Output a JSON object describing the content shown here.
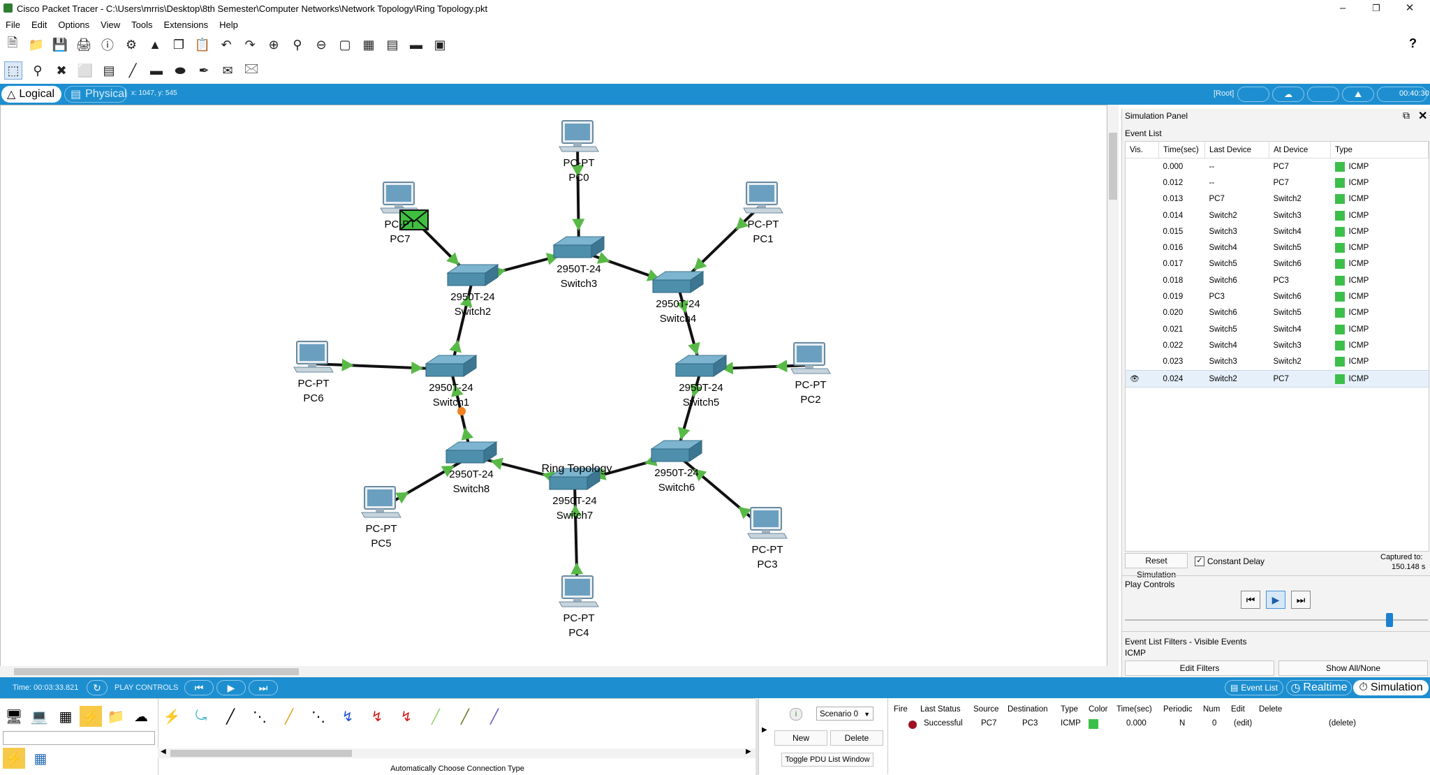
{
  "window": {
    "title": "Cisco Packet Tracer - C:\\Users\\mrris\\Desktop\\8th Semester\\Computer Networks\\Network Topology\\Ring Topology.pkt",
    "minimize": "–",
    "restore": "❐",
    "close": "✕"
  },
  "menu": [
    "File",
    "Edit",
    "Options",
    "View",
    "Tools",
    "Extensions",
    "Help"
  ],
  "help_icon": "?",
  "modebar": {
    "logical": "Logical",
    "physical": "Physical",
    "coords": "x: 1047, y: 545",
    "root": "[Root]",
    "clock": "00:40:30"
  },
  "topology": {
    "title": "Ring Topology",
    "switches": [
      {
        "id": "switch1",
        "model": "2950T-24",
        "name": "Switch1"
      },
      {
        "id": "switch2",
        "model": "2950T-24",
        "name": "Switch2"
      },
      {
        "id": "switch3",
        "model": "2950T-24",
        "name": "Switch3"
      },
      {
        "id": "switch4",
        "model": "2950T-24",
        "name": "Switch4"
      },
      {
        "id": "switch5",
        "model": "2950T-24",
        "name": "Switch5"
      },
      {
        "id": "switch6",
        "model": "2950T-24",
        "name": "Switch6"
      },
      {
        "id": "switch7",
        "model": "2950T-24",
        "name": "Switch7"
      },
      {
        "id": "switch8",
        "model": "2950T-24",
        "name": "Switch8"
      }
    ],
    "pcs": [
      {
        "id": "pc0",
        "model": "PC-PT",
        "name": "PC0"
      },
      {
        "id": "pc1",
        "model": "PC-PT",
        "name": "PC1"
      },
      {
        "id": "pc2",
        "model": "PC-PT",
        "name": "PC2"
      },
      {
        "id": "pc3",
        "model": "PC-PT",
        "name": "PC3"
      },
      {
        "id": "pc4",
        "model": "PC-PT",
        "name": "PC4"
      },
      {
        "id": "pc5",
        "model": "PC-PT",
        "name": "PC5"
      },
      {
        "id": "pc6",
        "model": "PC-PT",
        "name": "PC6"
      },
      {
        "id": "pc7",
        "model": "PC-PT",
        "name": "PC7"
      }
    ]
  },
  "simulation_panel": {
    "title": "Simulation Panel",
    "event_list_label": "Event List",
    "columns": [
      "Vis.",
      "Time(sec)",
      "Last Device",
      "At Device",
      "Type"
    ],
    "events": [
      {
        "time": "0.000",
        "last": "--",
        "at": "PC7",
        "type": "ICMP"
      },
      {
        "time": "0.012",
        "last": "--",
        "at": "PC7",
        "type": "ICMP"
      },
      {
        "time": "0.013",
        "last": "PC7",
        "at": "Switch2",
        "type": "ICMP"
      },
      {
        "time": "0.014",
        "last": "Switch2",
        "at": "Switch3",
        "type": "ICMP"
      },
      {
        "time": "0.015",
        "last": "Switch3",
        "at": "Switch4",
        "type": "ICMP"
      },
      {
        "time": "0.016",
        "last": "Switch4",
        "at": "Switch5",
        "type": "ICMP"
      },
      {
        "time": "0.017",
        "last": "Switch5",
        "at": "Switch6",
        "type": "ICMP"
      },
      {
        "time": "0.018",
        "last": "Switch6",
        "at": "PC3",
        "type": "ICMP"
      },
      {
        "time": "0.019",
        "last": "PC3",
        "at": "Switch6",
        "type": "ICMP"
      },
      {
        "time": "0.020",
        "last": "Switch6",
        "at": "Switch5",
        "type": "ICMP"
      },
      {
        "time": "0.021",
        "last": "Switch5",
        "at": "Switch4",
        "type": "ICMP"
      },
      {
        "time": "0.022",
        "last": "Switch4",
        "at": "Switch3",
        "type": "ICMP"
      },
      {
        "time": "0.023",
        "last": "Switch3",
        "at": "Switch2",
        "type": "ICMP"
      },
      {
        "time": "0.024",
        "last": "Switch2",
        "at": "PC7",
        "type": "ICMP",
        "selected": true
      }
    ],
    "icmp_color": "#3cbf4a",
    "reset_button": "Reset Simulation",
    "constant_delay": "Constant Delay",
    "constant_delay_checked": true,
    "captured_label": "Captured to:",
    "captured_value": "150.148 s",
    "play_controls_label": "Play Controls",
    "filters_label": "Event List Filters - Visible Events",
    "filters_value": "ICMP",
    "edit_filters": "Edit Filters",
    "show_all": "Show All/None"
  },
  "bottombar": {
    "time": "Time: 00:03:33.821",
    "play_controls": "PLAY CONTROLS",
    "event_list": "Event List",
    "realtime": "Realtime",
    "simulation": "Simulation"
  },
  "palette": {
    "connection_hint": "Automatically Choose Connection Type"
  },
  "pdu": {
    "scenario": "Scenario 0",
    "new_button": "New",
    "delete_button": "Delete",
    "toggle_button": "Toggle PDU List Window",
    "columns": [
      "Fire",
      "Last Status",
      "Source",
      "Destination",
      "Type",
      "Color",
      "Time(sec)",
      "Periodic",
      "Num",
      "Edit",
      "Delete"
    ],
    "row": {
      "status": "Successful",
      "source": "PC7",
      "destination": "PC3",
      "type": "ICMP",
      "time": "0.000",
      "periodic": "N",
      "num": "0",
      "edit": "(edit)",
      "delete": "(delete)"
    }
  },
  "colors": {
    "accent_blue": "#1d8fd0",
    "link_up_green": "#58b947",
    "switch_blue": "#4e8fab",
    "pc_blue": "#6b9fc0"
  }
}
